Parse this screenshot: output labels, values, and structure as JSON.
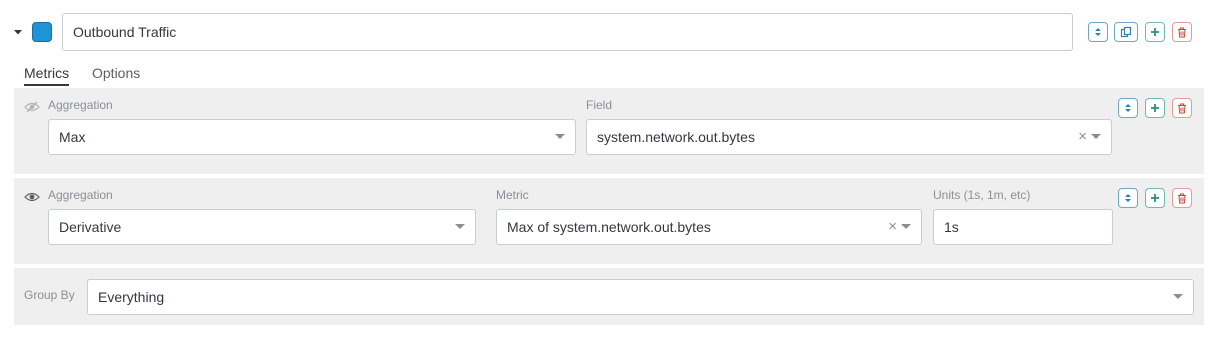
{
  "series": {
    "label": "Outbound Traffic",
    "color": "#1e94d4"
  },
  "tabs": [
    {
      "label": "Metrics",
      "active": true
    },
    {
      "label": "Options",
      "active": false
    }
  ],
  "metrics": [
    {
      "hidden": true,
      "aggregation_label": "Aggregation",
      "aggregation_value": "Max",
      "field_label": "Field",
      "field_value": "system.network.out.bytes"
    },
    {
      "hidden": false,
      "aggregation_label": "Aggregation",
      "aggregation_value": "Derivative",
      "metric_label": "Metric",
      "metric_value": "Max of system.network.out.bytes",
      "units_label": "Units (1s, 1m, etc)",
      "units_value": "1s"
    }
  ],
  "group_by": {
    "label": "Group By",
    "value": "Everything"
  },
  "icons": {
    "collapse": "caret-down-icon",
    "move": "sort-icon",
    "clone": "copy-icon",
    "add": "plus-icon",
    "delete": "trash-icon",
    "visibility_hidden": "eye-slash-icon",
    "visibility_visible": "eye-icon",
    "clear": "close-icon",
    "dropdown": "chevron-down-icon"
  },
  "colors": {
    "panel_bg": "#efefef",
    "accent_blue": "#2d7fb0",
    "accent_green": "#2b8f7e",
    "danger": "#c9463d"
  }
}
